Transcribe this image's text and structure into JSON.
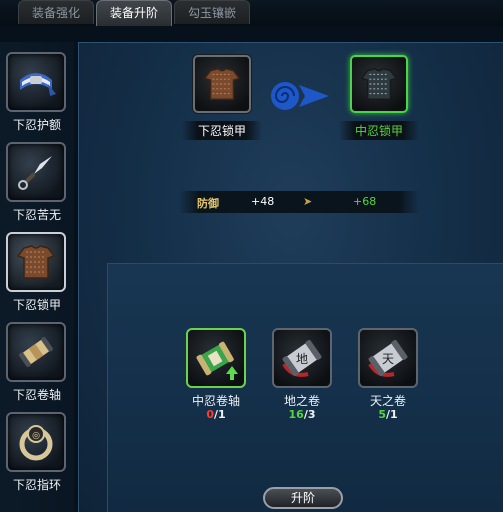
{
  "tabs": [
    {
      "label": "装备强化",
      "active": false
    },
    {
      "label": "装备升阶",
      "active": true
    },
    {
      "label": "勾玉镶嵌",
      "active": false
    },
    {
      "label": "",
      "active": false
    }
  ],
  "sidebar": {
    "items": [
      {
        "label": "下忍护额",
        "icon": "headband-icon",
        "selected": false
      },
      {
        "label": "下忍苦无",
        "icon": "kunai-icon",
        "selected": false
      },
      {
        "label": "下忍锁甲",
        "icon": "chainmail-icon",
        "selected": true
      },
      {
        "label": "下忍卷轴",
        "icon": "scroll-icon",
        "selected": false
      },
      {
        "label": "下忍指环",
        "icon": "ring-icon",
        "selected": false
      }
    ]
  },
  "upgrade": {
    "from": {
      "name": "下忍锁甲",
      "icon": "chainmail-icon",
      "color": "#ffffff"
    },
    "to": {
      "name": "中忍锁甲",
      "icon": "chainmail-icon",
      "color": "#59d43f"
    },
    "stat": {
      "name": "防御",
      "from": "+48",
      "to": "+68"
    }
  },
  "materials": [
    {
      "name": "中忍卷轴",
      "have": "0",
      "need": "/1",
      "status": "short",
      "icon": "scroll-upgrade-icon"
    },
    {
      "name": "地之卷",
      "have": "16",
      "need": "/3",
      "status": "ok",
      "icon": "earth-scroll-icon"
    },
    {
      "name": "天之卷",
      "have": "5",
      "need": "/1",
      "status": "ok",
      "icon": "heaven-scroll-icon"
    }
  ],
  "button": {
    "label": "升阶"
  },
  "colors": {
    "accent_green": "#59d43f",
    "shortage_red": "#ff3b30",
    "panel_blue": "#15304a"
  }
}
